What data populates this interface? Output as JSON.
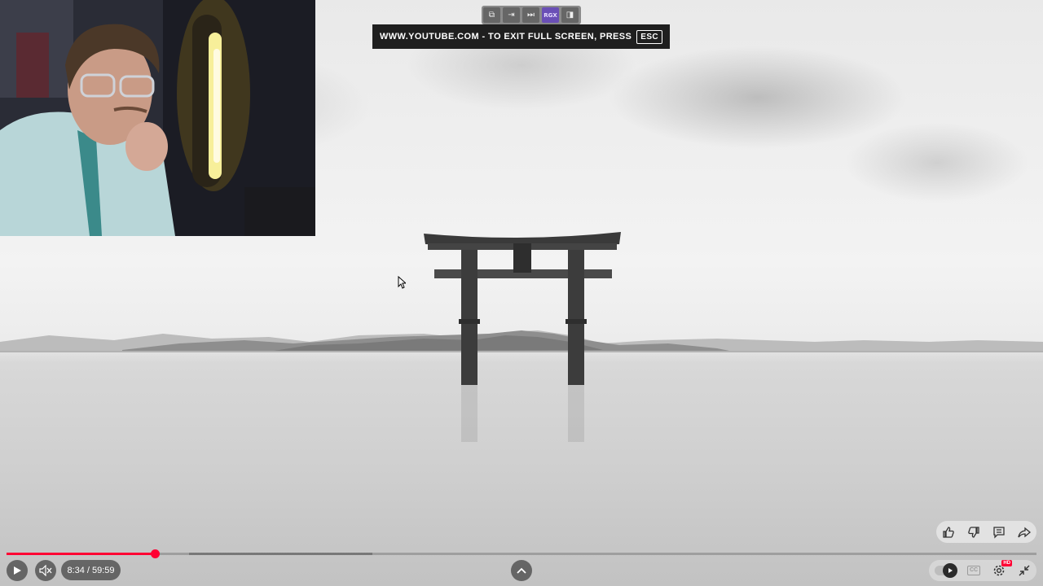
{
  "topbar": {
    "buttons": [
      {
        "name": "popout-icon",
        "glyph": "⧉",
        "active": false
      },
      {
        "name": "exit-icon",
        "glyph": "⇥",
        "active": false
      },
      {
        "name": "skip-icon",
        "glyph": "⏭",
        "active": false
      },
      {
        "name": "rgx-button",
        "label": "RGX",
        "active": true
      },
      {
        "name": "panel-icon",
        "glyph": "◨",
        "active": false
      }
    ]
  },
  "fullscreen_notice": {
    "text": "WWW.YOUTUBE.COM - TO EXIT FULL SCREEN, PRESS",
    "key": "ESC"
  },
  "player": {
    "current_time": "8:34",
    "duration": "59:59",
    "time_display": "8:34 / 59:59",
    "progress": 0.1438,
    "buffered_start": 0.177,
    "buffered": 0.178,
    "hd_badge": "HD",
    "cc_label": "CC",
    "accent_color": "#ff0033"
  },
  "actions": [
    "like-icon",
    "dislike-icon",
    "comments-icon",
    "share-icon"
  ]
}
